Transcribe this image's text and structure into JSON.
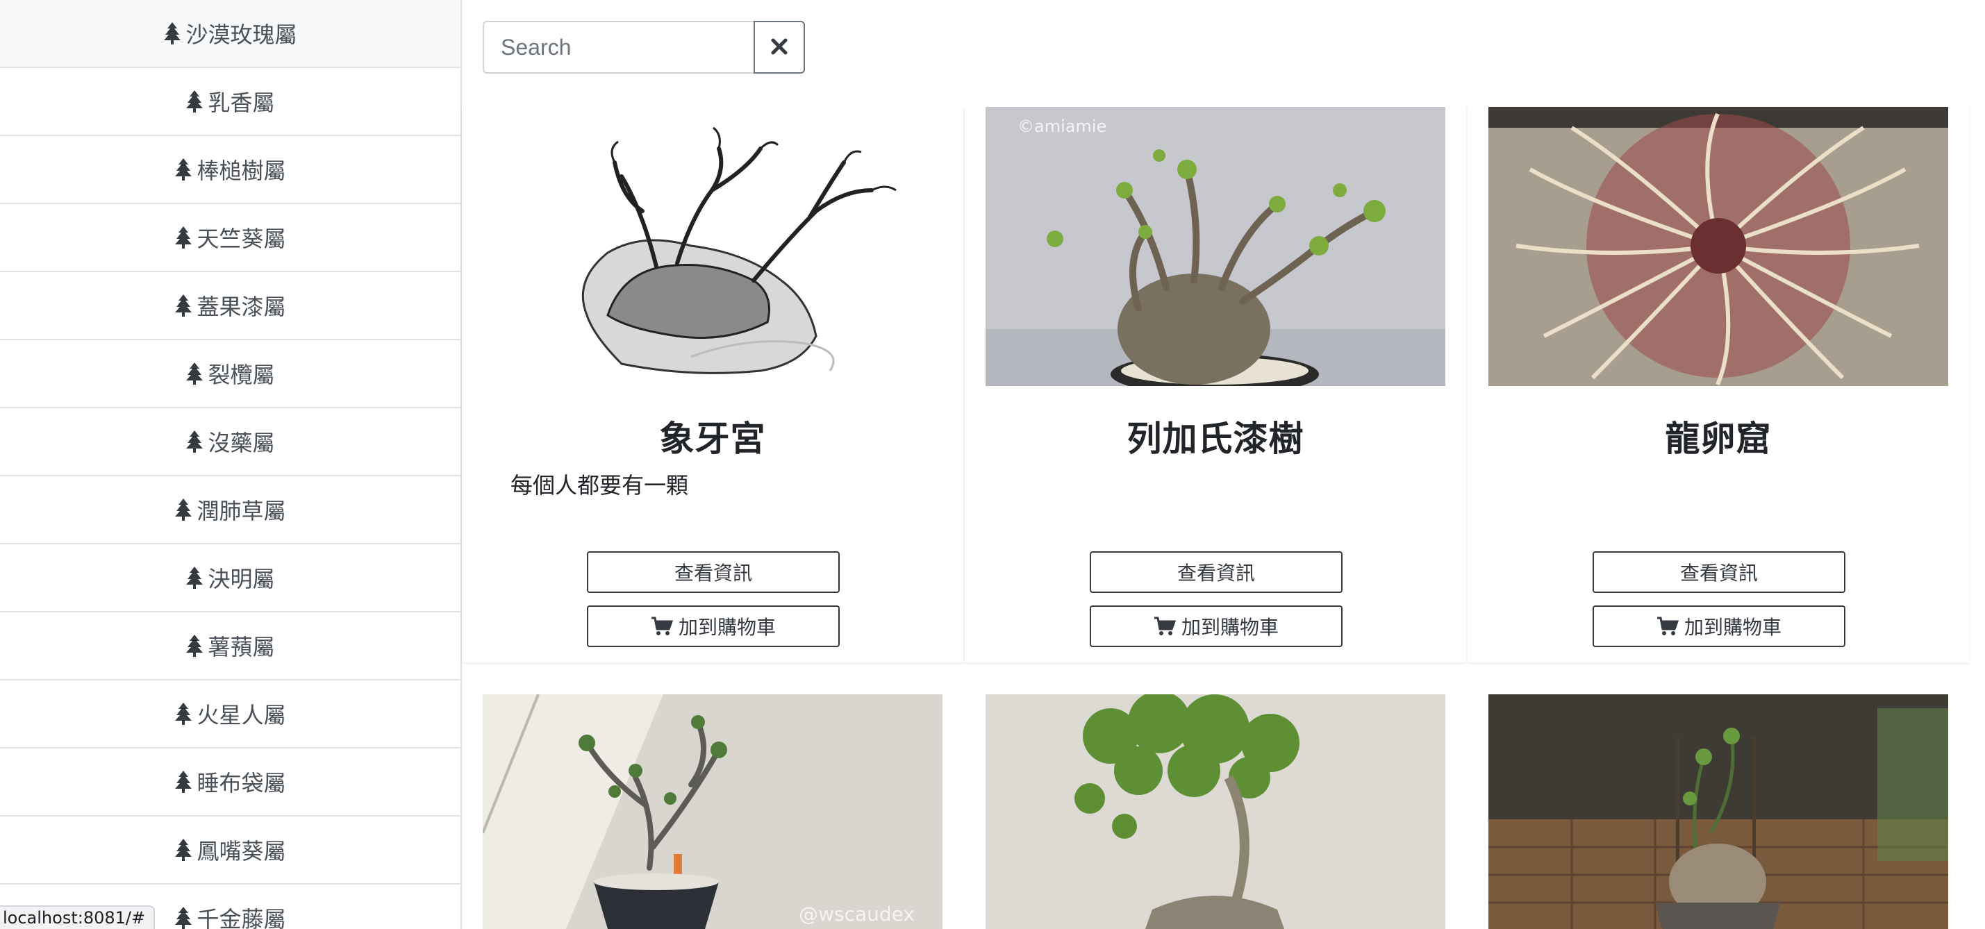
{
  "sidebar": {
    "items": [
      {
        "label": "沙漠玫瑰屬"
      },
      {
        "label": "乳香屬"
      },
      {
        "label": "棒槌樹屬"
      },
      {
        "label": "天竺葵屬"
      },
      {
        "label": "蓋果漆屬"
      },
      {
        "label": "裂欖屬"
      },
      {
        "label": "沒藥屬"
      },
      {
        "label": "潤肺草屬"
      },
      {
        "label": "決明屬"
      },
      {
        "label": "薯蕷屬"
      },
      {
        "label": "火星人屬"
      },
      {
        "label": "睡布袋屬"
      },
      {
        "label": "鳳嘴葵屬"
      },
      {
        "label": "千金藤屬"
      }
    ]
  },
  "status_url": "localhost:8081/#",
  "search": {
    "placeholder": "Search",
    "value": ""
  },
  "products": [
    {
      "title": "象牙宮",
      "description": "每個人都要有一顆",
      "info_label": "查看資訊",
      "cart_label": "加到購物車",
      "image_watermark": ""
    },
    {
      "title": "列加氏漆樹",
      "description": "",
      "info_label": "查看資訊",
      "cart_label": "加到購物車",
      "image_watermark": "©amiamie"
    },
    {
      "title": "龍卵窟",
      "description": "",
      "info_label": "查看資訊",
      "cart_label": "加到購物車",
      "image_watermark": ""
    },
    {
      "title": "",
      "description": "",
      "info_label": "",
      "cart_label": "",
      "image_watermark": "@wscaudex"
    },
    {
      "title": "",
      "description": "",
      "info_label": "",
      "cart_label": "",
      "image_watermark": ""
    },
    {
      "title": "",
      "description": "",
      "info_label": "",
      "cart_label": "",
      "image_watermark": ""
    }
  ],
  "icons": {
    "sidebar_item": "tree-icon",
    "clear": "times-icon",
    "cart": "shopping-cart-icon"
  },
  "colors": {
    "border": "#dee2e6",
    "button_border": "#343a40",
    "text": "#212529"
  }
}
